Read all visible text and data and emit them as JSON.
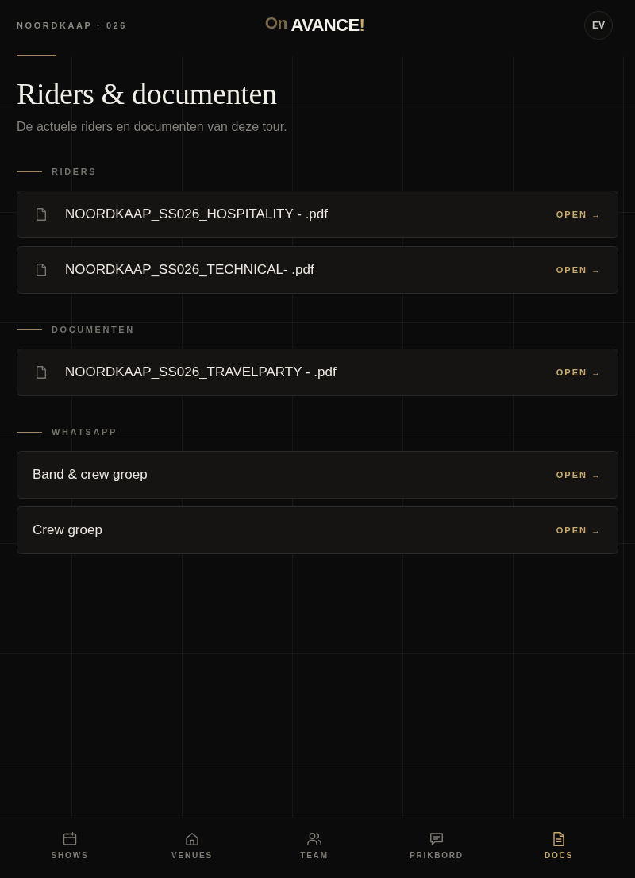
{
  "header": {
    "context": "NOORDKAAP · 026",
    "logo": {
      "prefix": "On",
      "name": "AVANCE",
      "accent": "!"
    },
    "avatar": "EV"
  },
  "page": {
    "title": "Riders & documenten",
    "subtitle": "De actuele riders en documenten van deze tour."
  },
  "sections": [
    {
      "title": "RIDERS",
      "items": [
        {
          "kind": "file",
          "name": "NOORDKAAP_SS026_HOSPITALITY - .pdf",
          "action": "OPEN →"
        },
        {
          "kind": "file",
          "name": "NOORDKAAP_SS026_TECHNICAL- .pdf",
          "action": "OPEN →"
        }
      ]
    },
    {
      "title": "DOCUMENTEN",
      "items": [
        {
          "kind": "file",
          "name": "NOORDKAAP_SS026_TRAVELPARTY - .pdf",
          "action": "OPEN →"
        }
      ]
    },
    {
      "title": "WHATSAPP",
      "items": [
        {
          "kind": "link",
          "name": "Band & crew groep",
          "action": "OPEN →"
        },
        {
          "kind": "link",
          "name": "Crew groep",
          "action": "OPEN →"
        }
      ]
    }
  ],
  "nav": [
    {
      "label": "SHOWS",
      "selected": false
    },
    {
      "label": "VENUES",
      "selected": false
    },
    {
      "label": "TEAM",
      "selected": false
    },
    {
      "label": "PRIKBORD",
      "selected": false
    },
    {
      "label": "DOCS",
      "selected": true
    }
  ]
}
